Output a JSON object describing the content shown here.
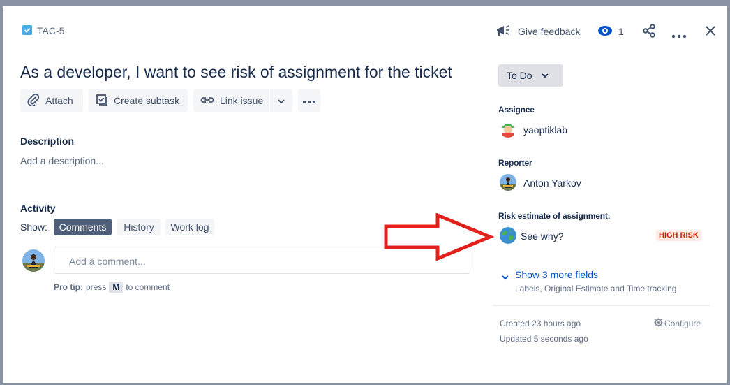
{
  "issue": {
    "key": "TAC-5",
    "title": "As a developer, I want to see risk of assignment for the ticket"
  },
  "header": {
    "feedback_label": "Give feedback",
    "watch_count": "1"
  },
  "toolbar": {
    "attach_label": "Attach",
    "subtask_label": "Create subtask",
    "link_label": "Link issue"
  },
  "description": {
    "heading": "Description",
    "placeholder": "Add a description..."
  },
  "activity": {
    "heading": "Activity",
    "show_label": "Show:",
    "tabs": [
      "Comments",
      "History",
      "Work log"
    ],
    "comment_placeholder": "Add a comment...",
    "protip_bold": "Pro tip:",
    "protip_press": "press",
    "protip_key": "M",
    "protip_rest": "to comment"
  },
  "sidebar": {
    "status_label": "To Do",
    "assignee_label": "Assignee",
    "assignee_name": "yaoptiklab",
    "reporter_label": "Reporter",
    "reporter_name": "Anton Yarkov",
    "risk_label": "Risk estimate of assignment:",
    "risk_link": "See why?",
    "risk_badge": "HIGH RISK",
    "more_fields_label": "Show 3 more fields",
    "more_fields_sub": "Labels, Original Estimate and Time tracking",
    "created": "Created 23 hours ago",
    "updated": "Updated 5 seconds ago",
    "configure_label": "Configure"
  },
  "colors": {
    "accent": "#0052cc",
    "annotation_arrow": "#e3211c",
    "risk_badge_bg": "#ffebe6",
    "risk_badge_text": "#bf2600"
  }
}
